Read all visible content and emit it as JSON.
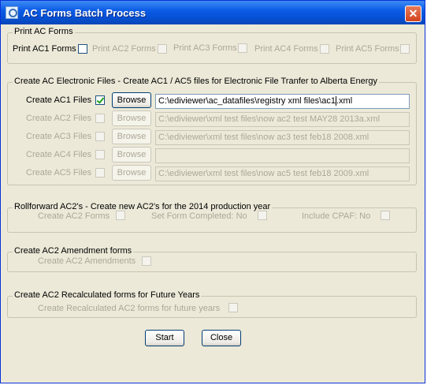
{
  "window": {
    "title": "AC Forms Batch Process",
    "close_glyph": "✕"
  },
  "print_group": {
    "legend": "Print AC Forms",
    "items": [
      {
        "label": "Print AC1 Forms",
        "enabled": true
      },
      {
        "label": "Print AC2 Forms",
        "enabled": false
      },
      {
        "label": "Print AC3 Forms",
        "enabled": false
      },
      {
        "label": "Print AC4 Forms",
        "enabled": false
      },
      {
        "label": "Print AC5 Forms",
        "enabled": false
      }
    ]
  },
  "electronic_group": {
    "legend": "Create AC Electronic Files - Create AC1 / AC5 files for Electronic File Tranfer to Alberta Energy",
    "browse_label": "Browse",
    "rows": [
      {
        "label": "Create AC1 Files",
        "checked": true,
        "enabled": true,
        "path_before_caret": "C:\\ediviewer\\ac_datafiles\\registry xml files\\ac1",
        "path_after_caret": ".xml"
      },
      {
        "label": "Create AC2 Files",
        "checked": false,
        "enabled": false,
        "path": "C:\\ediviewer\\xml test files\\now ac2 test MAY28 2013a.xml"
      },
      {
        "label": "Create AC3 Files",
        "checked": false,
        "enabled": false,
        "path": "C:\\ediviewer\\xml test files\\now ac3 test feb18 2008.xml"
      },
      {
        "label": "Create AC4 Files",
        "checked": false,
        "enabled": false,
        "path": ""
      },
      {
        "label": "Create AC5 Files",
        "checked": false,
        "enabled": false,
        "path": "C:\\ediviewer\\xml test files\\now ac5 test feb18 2009.xml"
      }
    ]
  },
  "rollforward_group": {
    "legend": "Rollforward AC2's - Create new AC2's for the 2014 production year",
    "create_label": "Create AC2 Forms",
    "set_completed_label": "Set Form Completed:  No",
    "include_cpaf_label": "Include CPAF:  No"
  },
  "amendment_group": {
    "legend": "Create AC2 Amendment forms",
    "item_label": "Create AC2 Amendments"
  },
  "recalc_group": {
    "legend": "Create AC2 Recalculated forms for Future Years",
    "item_label": "Create Recalculated AC2 forms for future years"
  },
  "buttons": {
    "start": "Start",
    "close": "Close"
  }
}
